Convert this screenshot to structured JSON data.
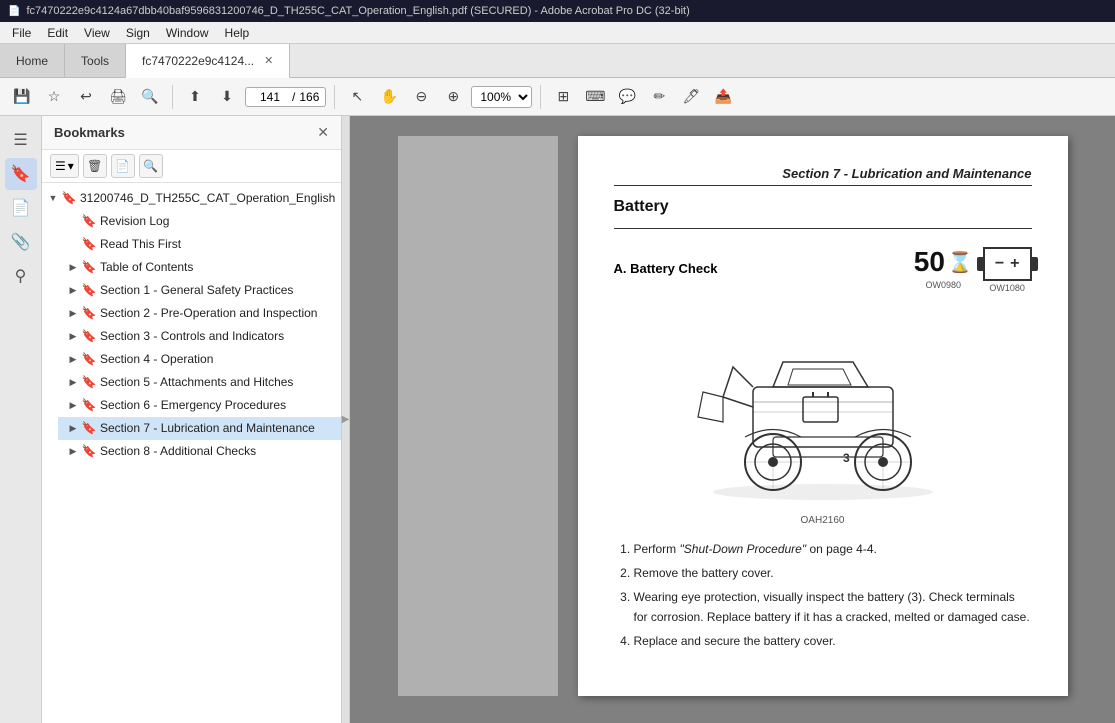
{
  "titleBar": {
    "text": "fc7470222e9c4124a67dbb40baf9596831200746_D_TH255C_CAT_Operation_English.pdf (SECURED) - Adobe Acrobat Pro DC (32-bit)"
  },
  "menuBar": {
    "items": [
      "File",
      "Edit",
      "View",
      "Sign",
      "Window",
      "Help"
    ]
  },
  "tabs": [
    {
      "label": "Home",
      "active": false
    },
    {
      "label": "Tools",
      "active": false
    },
    {
      "label": "fc7470222e9c4124...",
      "active": true,
      "closeable": true
    }
  ],
  "toolbar": {
    "currentPage": "141",
    "totalPages": "166",
    "zoom": "100%"
  },
  "bookmarksPanel": {
    "title": "Bookmarks",
    "rootItem": {
      "label": "31200746_D_TH255C_CAT_Operation_English",
      "expanded": true
    },
    "items": [
      {
        "id": "revision-log",
        "label": "Revision Log",
        "expandable": false,
        "indent": 1
      },
      {
        "id": "read-this-first",
        "label": "Read This First",
        "expandable": false,
        "indent": 1
      },
      {
        "id": "table-of-contents",
        "label": "Table of Contents",
        "expandable": true,
        "indent": 1
      },
      {
        "id": "section-1",
        "label": "Section 1 - General Safety Practices",
        "expandable": true,
        "indent": 1
      },
      {
        "id": "section-2",
        "label": "Section 2 - Pre-Operation and Inspection",
        "expandable": true,
        "indent": 1
      },
      {
        "id": "section-3",
        "label": "Section 3 - Controls and Indicators",
        "expandable": true,
        "indent": 1
      },
      {
        "id": "section-4",
        "label": "Section 4 - Operation",
        "expandable": true,
        "indent": 1
      },
      {
        "id": "section-5",
        "label": "Section 5 - Attachments and Hitches",
        "expandable": true,
        "indent": 1
      },
      {
        "id": "section-6",
        "label": "Section 6 - Emergency Procedures",
        "expandable": true,
        "indent": 1
      },
      {
        "id": "section-7",
        "label": "Section 7 - Lubrication and Maintenance",
        "expandable": true,
        "indent": 1,
        "active": true
      },
      {
        "id": "section-8",
        "label": "Section 8 - Additional Checks",
        "expandable": true,
        "indent": 1
      }
    ]
  },
  "pdfContent": {
    "sectionHeader": "Section 7 - Lubrication and Maintenance",
    "pageTitle": "Battery",
    "batteryCheckLabel": "A. Battery Check",
    "batteryNumber": "50",
    "iconCode1": "OW0980",
    "iconCode2": "OW1080",
    "imageCaption": "OAH2160",
    "instructions": [
      {
        "num": 1,
        "text": "Perform ",
        "italic": "\"Shut-Down Procedure\"",
        "textAfter": " on page 4-4."
      },
      {
        "num": 2,
        "text": "Remove the battery cover.",
        "italic": "",
        "textAfter": ""
      },
      {
        "num": 3,
        "text": "Wearing eye protection, visually inspect the battery (3). Check terminals for corrosion. Replace battery if it has a cracked, melted or damaged case.",
        "italic": "",
        "textAfter": ""
      },
      {
        "num": 4,
        "text": "Replace and secure the battery cover.",
        "italic": "",
        "textAfter": ""
      }
    ]
  }
}
